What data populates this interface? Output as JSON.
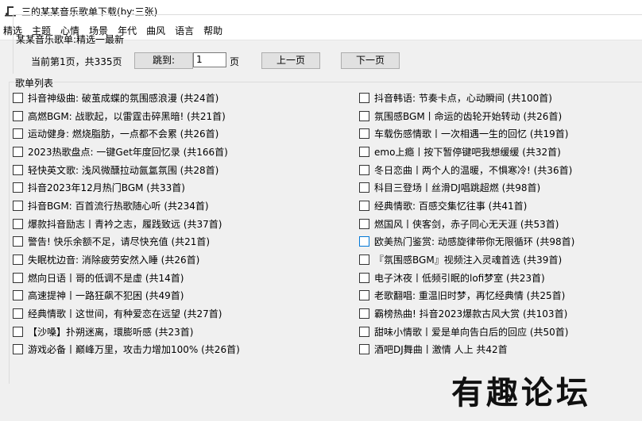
{
  "window": {
    "title": "三的某某音乐歌单下载(by:三张)"
  },
  "menu": [
    "精选",
    "主题",
    "心情",
    "场景",
    "年代",
    "曲风",
    "语言",
    "帮助"
  ],
  "header": {
    "list_title": "某某音乐歌单:精选一最新"
  },
  "pager": {
    "status": "当前第1页，共335页",
    "goto_label": "跳到:",
    "page_value": "1",
    "page_unit": "页",
    "prev_label": "上一页",
    "next_label": "下一页"
  },
  "songs_group_label": "歌单列表",
  "left_items": [
    "抖音神级曲: 破茧成蝶的氛围感浪漫 (共24首)",
    "高燃BGM: 战歌起，以雷霆击碎黑暗! (共21首)",
    "运动健身: 燃烧脂肪，一点都不会累 (共26首)",
    "2023热歌盘点: 一键Get年度回忆录 (共166首)",
    "轻快英文歌: 浅风微醺拉动氤氲氛围 (共28首)",
    "抖音2023年12月热门BGM (共33首)",
    "抖音BGM: 百首流行热歌随心听 (共234首)",
    "爆款抖音励志丨青衿之志，履践致远 (共37首)",
    "警告! 快乐余额不足，请尽快充值 (共21首)",
    "失眠枕边音: 消除疲劳安然入睡 (共26首)",
    "燃向日语丨哥的低调不是虚 (共14首)",
    "高速提神丨一路狂飙不犯困 (共49首)",
    "经典情歌丨这世间，有种爱恋在远望 (共27首)",
    "【沙嗓】扑朔迷离，環膨听感 (共23首)",
    "游戏必备丨巅峰万里，攻击力增加100% (共26首)"
  ],
  "right_items": [
    "抖音韩语: 节奏卡点，心动瞬间 (共100首)",
    "氛围感BGM丨命运的齿轮开始转动 (共26首)",
    "车载伤感情歌丨一次相遇一生的回忆 (共19首)",
    "emo上瘾丨按下暂停键吧我想缓缓 (共32首)",
    "冬日恋曲丨两个人的温暖，不惧寒冷! (共36首)",
    "科目三登场丨丝滑DJ唱跳超燃 (共98首)",
    "经典情歌: 百感交集忆往事 (共41首)",
    "燃国风丨侠客剑，赤子同心无天涯 (共53首)",
    "欧美热门鉴赏: 动感旋律带你无限循环 (共98首)",
    "『氛围感BGM』视频注入灵魂首选 (共39首)",
    "电子沐夜丨低频引眠的lofi梦室 (共23首)",
    "老歌翻唱: 重温旧时梦，再忆经典情 (共25首)",
    "霸榜热曲! 抖音2023爆款古风大赏 (共103首)",
    "甜味小情歌丨爱是单向告白后的回应 (共50首)",
    "酒吧DJ舞曲丨激情 人上 共42首"
  ],
  "watermark": "有趣论坛"
}
